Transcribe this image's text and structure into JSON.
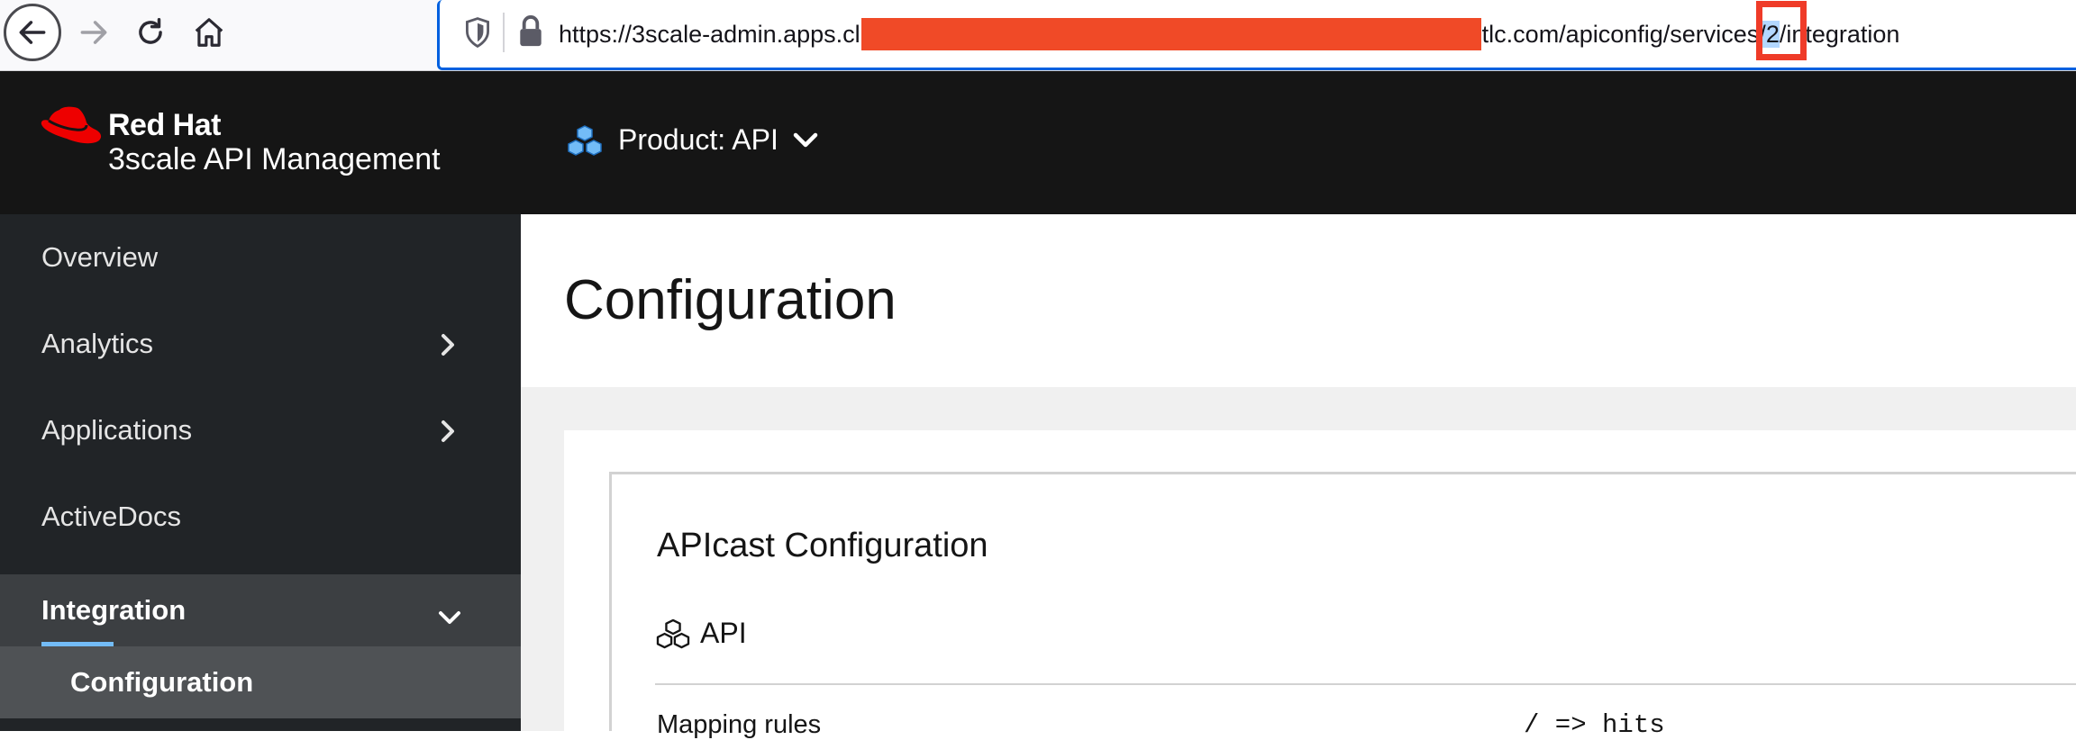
{
  "browser": {
    "url_prefix": "https://3scale-admin.apps.cl",
    "url_middle": "tlc.com/apiconfig/service",
    "url_service_sep": "s",
    "url_id_slash_open": "/",
    "url_service_id": "2",
    "url_id_slash_close": "/",
    "url_suffix": "integration"
  },
  "masthead": {
    "brand_name": "Red Hat",
    "brand_product": "3scale API Management",
    "context_label": "Product: API"
  },
  "sidebar": {
    "items": [
      {
        "label": "Overview"
      },
      {
        "label": "Analytics"
      },
      {
        "label": "Applications"
      },
      {
        "label": "ActiveDocs"
      },
      {
        "label": "Integration"
      }
    ],
    "sub_items": [
      {
        "label": "Configuration"
      }
    ]
  },
  "main": {
    "page_title": "Configuration",
    "panel_title": "APIcast Configuration",
    "api_name": "API",
    "mapping_label": "Mapping rules",
    "mapping_value": "/ => hits"
  },
  "colors": {
    "masthead_bg": "#151515",
    "sidebar_bg": "#212427",
    "active_underline": "#73bcf7",
    "redaction": "#f04a27",
    "annotation_box": "#ef3b28"
  }
}
